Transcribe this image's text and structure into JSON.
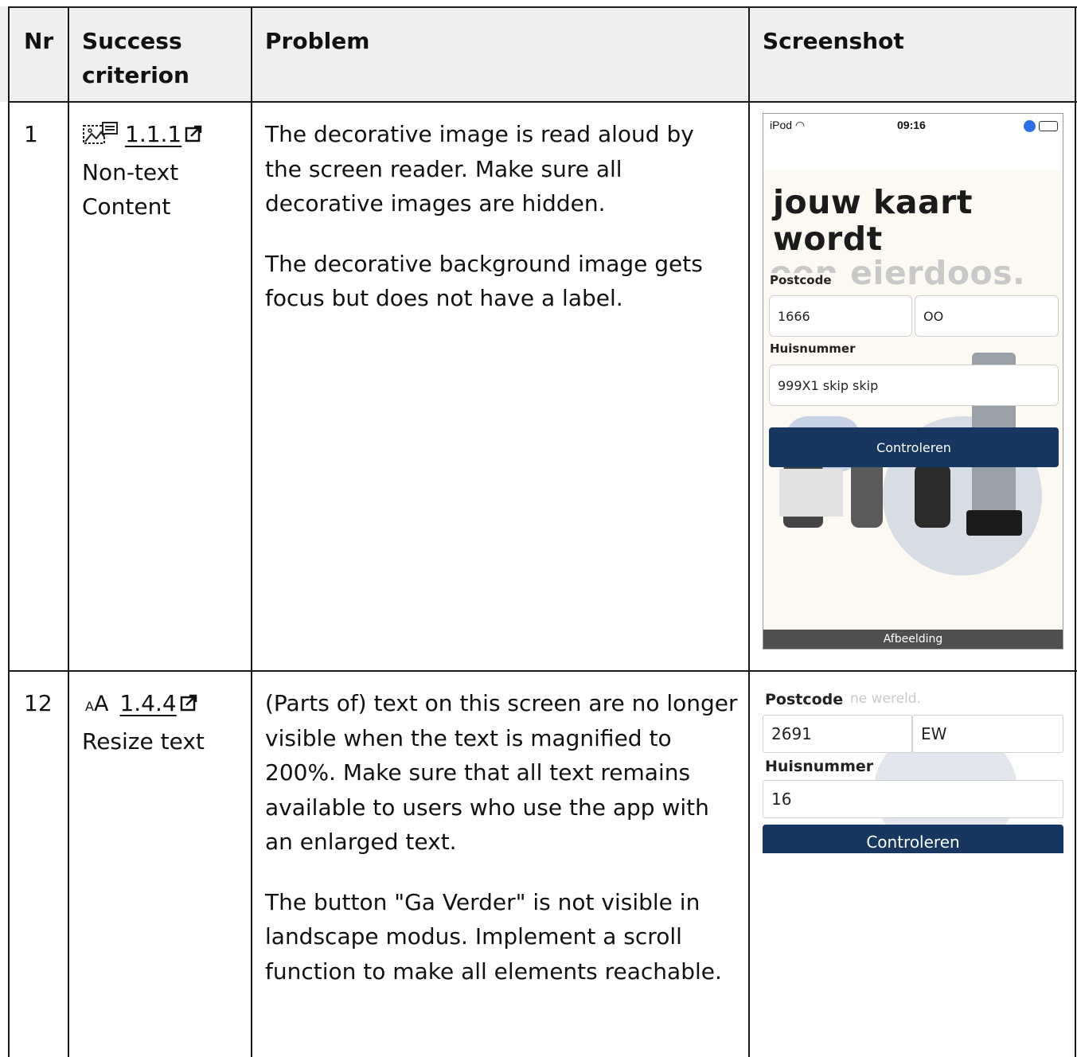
{
  "table": {
    "headers": {
      "nr": "Nr",
      "criterion": "Success criterion",
      "problem": "Problem",
      "screenshot": "Screenshot"
    },
    "rows": [
      {
        "nr": "1",
        "criterion_code": "1.1.1",
        "criterion_name": "Non-text Content",
        "criterion_icon": "image-text-icon",
        "problem_paragraphs": [
          "The decorative image is read aloud by the screen reader. Make sure all decorative images are hidden.",
          "The decorative background image gets focus but does not have a label."
        ],
        "screenshot": {
          "status_left": "iPod",
          "status_time": "09:16",
          "title_line1": "jouw kaart",
          "title_line2": "wordt",
          "title_faded": "een eierdoos.",
          "postcode_label": "Postcode",
          "postcode_digits": "1666",
          "postcode_letters": "OO",
          "housenumber_label": "Huisnummer",
          "housenumber_value": "999X1 skip skip",
          "button_label": "Controleren",
          "voiceover_caption": "Afbeelding"
        }
      },
      {
        "nr": "12",
        "criterion_code": "1.4.4",
        "criterion_name": "Resize text",
        "criterion_icon": "text-resize-icon",
        "problem_paragraphs": [
          "(Parts of) text on this screen are no longer visible when the text is magnified to 200%. Make sure that all text remains available to users who use the app with an enlarged text.",
          "The button \"Ga Verder\" is not visible in landscape modus. Implement a scroll function to make all elements reachable."
        ],
        "screenshot": {
          "postcode_label": "Postcode",
          "overlap_text": "ne wereld.",
          "postcode_digits": "2691",
          "postcode_letters": "EW",
          "housenumber_label": "Huisnummer",
          "housenumber_value": "16",
          "button_label": "Controleren"
        }
      }
    ]
  }
}
